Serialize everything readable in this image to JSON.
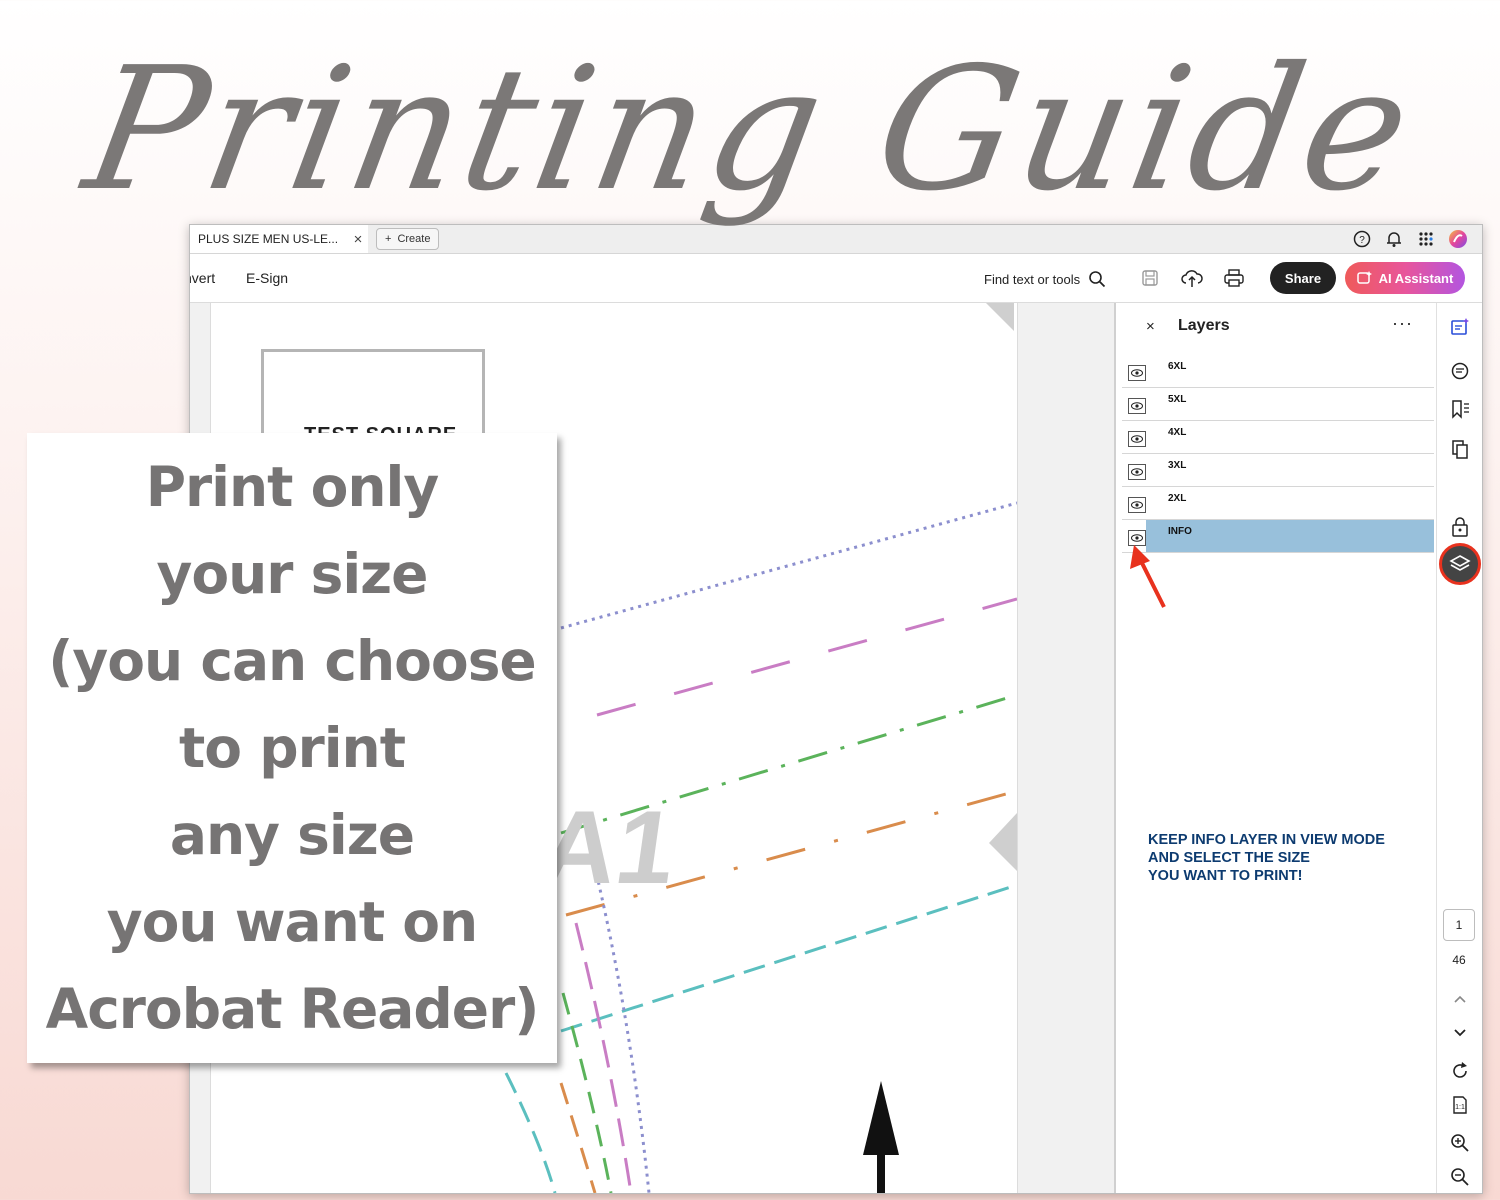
{
  "headline": "Printing Guide",
  "callout": {
    "lines": [
      "Print only",
      "your size",
      "(you can choose",
      "to print",
      "any size",
      "you want on",
      "Acrobat Reader)"
    ]
  },
  "app": {
    "tab_title": "PLUS SIZE MEN US-LE...",
    "tab_close": "×",
    "create_label": "Create",
    "menu": {
      "convert": "nvert",
      "esign": "E-Sign"
    },
    "find_label": "Find text or tools",
    "share_label": "Share",
    "ai_label": "AI Assistant"
  },
  "document": {
    "test_square_label": "TEST SQUARE",
    "piece_label": "A1"
  },
  "layers_panel": {
    "close": "×",
    "title": "Layers",
    "more": "···",
    "layers": [
      {
        "name": "6XL",
        "selected": false
      },
      {
        "name": "5XL",
        "selected": false
      },
      {
        "name": "4XL",
        "selected": false
      },
      {
        "name": "3XL",
        "selected": false
      },
      {
        "name": "2XL",
        "selected": false
      },
      {
        "name": "INFO",
        "selected": true
      }
    ],
    "annotation": [
      "KEEP INFO LAYER IN VIEW MODE",
      "AND SELECT THE SIZE",
      "YOU WANT TO PRINT!"
    ]
  },
  "page_nav": {
    "current": "1",
    "total": "46"
  },
  "colors": {
    "accent_red": "#e8321e",
    "layer_selected": "#98c0db",
    "annotation_text": "#0d3b70",
    "headline": "#7b7877"
  }
}
